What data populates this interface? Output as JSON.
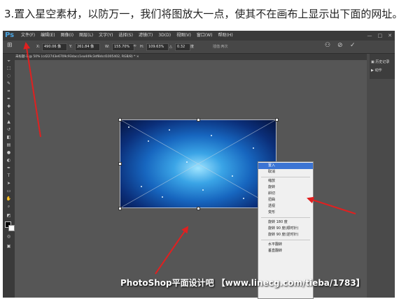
{
  "caption": "3.置入星空素材，以防万一，我们将图放大一点，使其不在画布上显示出下面的网址。",
  "app": {
    "logo": "Ps"
  },
  "menubar": {
    "items": [
      {
        "label": "文件(F)"
      },
      {
        "label": "编辑(E)"
      },
      {
        "label": "图像(I)"
      },
      {
        "label": "图层(L)"
      },
      {
        "label": "文字(Y)"
      },
      {
        "label": "选择(S)"
      },
      {
        "label": "滤镜(T)"
      },
      {
        "label": "3D(D)"
      },
      {
        "label": "视图(V)"
      },
      {
        "label": "窗口(W)"
      },
      {
        "label": "帮助(H)"
      }
    ],
    "window_buttons": [
      "—",
      "□",
      "✕"
    ]
  },
  "options": {
    "x_label": "X:",
    "x_value": "490.06 像",
    "y_label": "Y:",
    "y_value": "261.84 像",
    "w_label": "W:",
    "w_value": "155.70%",
    "h_label": "H:",
    "h_value": "109.63%",
    "angle_label": "△",
    "angle_value": "0.32",
    "angle_unit": "度",
    "interp_label": "插值:两次"
  },
  "document_tab": {
    "label": "未标题-1 @ 50% (cd22743e6709c93dacc1ea449c3df8dcd1005402, RGB/8) *",
    "close": "×"
  },
  "panel": {
    "items": [
      {
        "label": "历史记录"
      },
      {
        "label": "动作"
      }
    ]
  },
  "context_menu": {
    "items": [
      {
        "label": "置入",
        "highlighted": true
      },
      {
        "label": "取消"
      },
      {
        "label": "缩放"
      },
      {
        "label": "旋转"
      },
      {
        "label": "斜切"
      },
      {
        "label": "扭曲"
      },
      {
        "label": "透视"
      },
      {
        "label": "变形"
      },
      {
        "label": "旋转 180 度"
      },
      {
        "label": "旋转 90 度(顺时针)"
      },
      {
        "label": "旋转 90 度(逆时针)"
      },
      {
        "label": "水平翻转"
      },
      {
        "label": "垂直翻转"
      }
    ]
  },
  "watermark": "PhotoShop平面设计吧 【www.linecg.com/tieba/1783】",
  "colors": {
    "arrow": "#e02020",
    "highlight": "#3b74d4",
    "ps_logo": "#4aa3df"
  }
}
